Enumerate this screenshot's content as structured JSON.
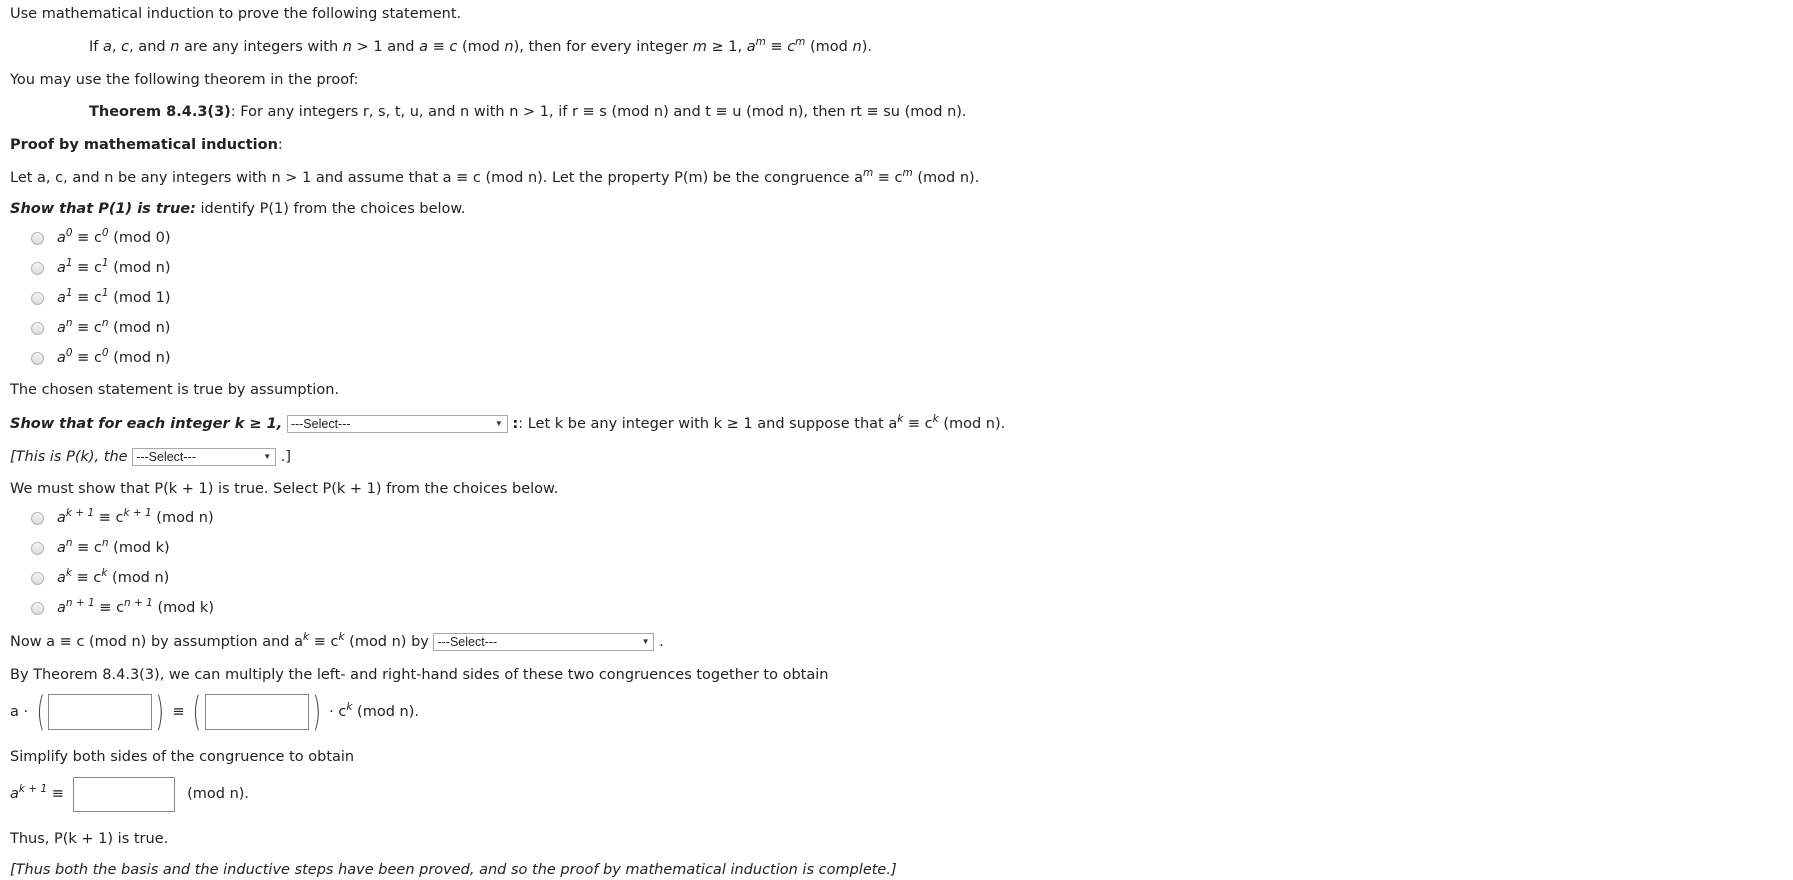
{
  "intro": "Use mathematical induction to prove the following statement.",
  "statement": {
    "p1": "If ",
    "a": "a",
    "c1": ", ",
    "c": "c",
    "c2": ", and ",
    "n": "n",
    "t1": " are any integers with ",
    "n2": "n",
    "t2": " > 1 and ",
    "a2": "a",
    "t3": " ≡ ",
    "c3": "c",
    "t4": " (mod ",
    "n3": "n",
    "t5": "), then for every integer ",
    "m": "m",
    "t6": " ≥ 1, ",
    "a3": "a",
    "exp": "m",
    "t7": " ≡ ",
    "c4": "c",
    "exp2": "m",
    "t8": " (mod ",
    "n4": "n",
    "t9": ")."
  },
  "theorem_intro": "You may use the following theorem in the proof:",
  "theorem": {
    "label": "Theorem 8.4.3(3)",
    "text": ": For any integers r, s, t, u, and n with n > 1, if r ≡ s (mod n) and t ≡ u (mod n), then rt ≡ su (mod n)."
  },
  "proof_heading": "Proof by mathematical induction",
  "proof_heading_colon": ":",
  "setup": "Let a, c, and n be any integers with n > 1 and assume that a ≡ c (mod n). Let the property P(m) be the congruence a",
  "setup_exp": "m",
  "setup_mid": " ≡ c",
  "setup_exp2": "m",
  "setup_end": " (mod n).",
  "basis": {
    "heading": "Show that P(1) is true:",
    "text": " identify P(1) from the choices below.",
    "choices": [
      {
        "base": "a",
        "e1": "0",
        "mid": " ≡ c",
        "e2": "0",
        "mod": " (mod 0)"
      },
      {
        "base": "a",
        "e1": "1",
        "mid": " ≡ c",
        "e2": "1",
        "mod": " (mod n)"
      },
      {
        "base": "a",
        "e1": "1",
        "mid": " ≡ c",
        "e2": "1",
        "mod": " (mod 1)"
      },
      {
        "base": "a",
        "e1": "n",
        "mid": " ≡ c",
        "e2": "n",
        "mod": " (mod n)"
      },
      {
        "base": "a",
        "e1": "0",
        "mid": " ≡ c",
        "e2": "0",
        "mod": " (mod n)"
      }
    ],
    "conclusion": "The chosen statement is true by assumption."
  },
  "inductive": {
    "heading": "Show that for each integer k ≥ 1,",
    "select1": "---Select---",
    "after": ": Let k be any integer with k ≥ 1 and suppose that a",
    "after_exp": "k",
    "after_mid": " ≡ c",
    "after_exp2": "k",
    "after_end": " (mod n).",
    "bracket_start": "[This is P(k), the",
    "select2": "---Select---",
    "bracket_end": ".]",
    "must_show": "We must show that P(k + 1) is true. Select P(k + 1) from the choices below.",
    "choices": [
      {
        "base": "a",
        "e1": "k + 1",
        "mid": " ≡ c",
        "e2": "k + 1",
        "mod": " (mod n)"
      },
      {
        "base": "a",
        "e1": "n",
        "mid": " ≡ c",
        "e2": "n",
        "mod": " (mod k)"
      },
      {
        "base": "a",
        "e1": "k",
        "mid": " ≡ c",
        "e2": "k",
        "mod": " (mod n)"
      },
      {
        "base": "a",
        "e1": "n + 1",
        "mid": " ≡ c",
        "e2": "n + 1",
        "mod": " (mod k)"
      }
    ],
    "now": "Now a ≡ c (mod n) by assumption and a",
    "now_exp": "k",
    "now_mid": " ≡ c",
    "now_exp2": "k",
    "now_end": " (mod n) by",
    "select3": "---Select---",
    "now_period": ".",
    "multiply": "By Theorem 8.4.3(3), we can multiply the left- and right-hand sides of these two congruences together to obtain",
    "eq_a": "a ·",
    "eq_equiv": "≡",
    "eq_tail": "· c",
    "eq_tail_exp": "k",
    "eq_tail_end": " (mod n).",
    "box1_value": "",
    "box2_value": "",
    "simplify": "Simplify both sides of the congruence to obtain",
    "simp_a": "a",
    "simp_exp": "k + 1",
    "simp_equiv": " ≡",
    "box3_value": "",
    "simp_end": "(mod n).",
    "thus": "Thus, P(k + 1) is true.",
    "final": "[Thus both the basis and the inductive steps have been proved, and so the proof by mathematical induction is complete.]"
  },
  "icons": {
    "dropdown": "▼"
  }
}
